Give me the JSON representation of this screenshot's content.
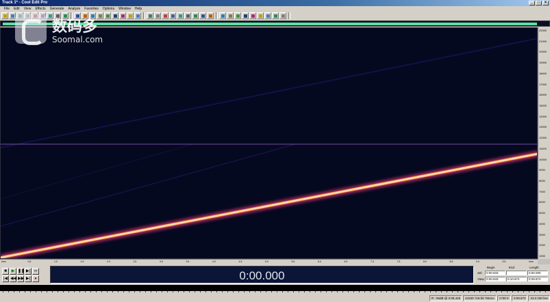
{
  "window": {
    "title": "Track 1* - Cool Edit Pro",
    "controls": [
      "_",
      "□",
      "×"
    ]
  },
  "menu": [
    "File",
    "Edit",
    "View",
    "Effects",
    "Generate",
    "Analyze",
    "Favorites",
    "Options",
    "Window",
    "Help"
  ],
  "spectral": {
    "divider_color": "#7050a0",
    "sweep_color": "#ffe0c0",
    "y_ticks": [
      "22000",
      "21000",
      "20000",
      "19000",
      "18000",
      "17000",
      "16000",
      "15000",
      "14000",
      "13000",
      "12000",
      "11000",
      "10000",
      "9000",
      "8000",
      "7000",
      "6000",
      "5000",
      "4000",
      "3000",
      "2000",
      "1000"
    ],
    "x_ticks": [
      "hms",
      "0.5",
      "1.0",
      "1.5",
      "2.0",
      "2.5",
      "3.0",
      "3.5",
      "4.0",
      "4.5",
      "5.0",
      "5.5",
      "6.0",
      "6.5",
      "7.0",
      "7.5",
      "8.0",
      "8.5",
      "9.0",
      "9.5",
      "hms"
    ]
  },
  "transport": {
    "row1": [
      "■",
      "▶",
      "❚❚",
      "▶|",
      "∞"
    ],
    "row2": [
      "|◀",
      "◀◀",
      "▶▶",
      "▶|",
      "●"
    ]
  },
  "time_display": "0:00.000",
  "selection": {
    "headers": [
      "Begin",
      "End",
      "Length"
    ],
    "rows": [
      {
        "label": "Sel",
        "begin": "0:00.833",
        "end": "",
        "length": "0:00.000"
      },
      {
        "label": "View",
        "begin": "0:00.833",
        "end": "0:10.872",
        "length": "0:09.872"
      }
    ]
  },
  "status": [
    "R: -55dB @ 0:08.425",
    "44100 ?16-bit ?Mono",
    "1730 K",
    "0:09.873",
    "23.3 GB free"
  ],
  "watermark": {
    "cn": "数码多",
    "en": "Soomal.com"
  },
  "toolbar_colors": [
    "#c0a000",
    "#4080c0",
    "#2e8b57",
    "#808080",
    "#c04040",
    "#4060a0",
    "#20a0a0",
    "#606060",
    "#2e8b57",
    "#3050a0",
    "#c06000",
    "#2080c0",
    "#808040",
    "#409040",
    "#204080",
    "#a03070"
  ]
}
